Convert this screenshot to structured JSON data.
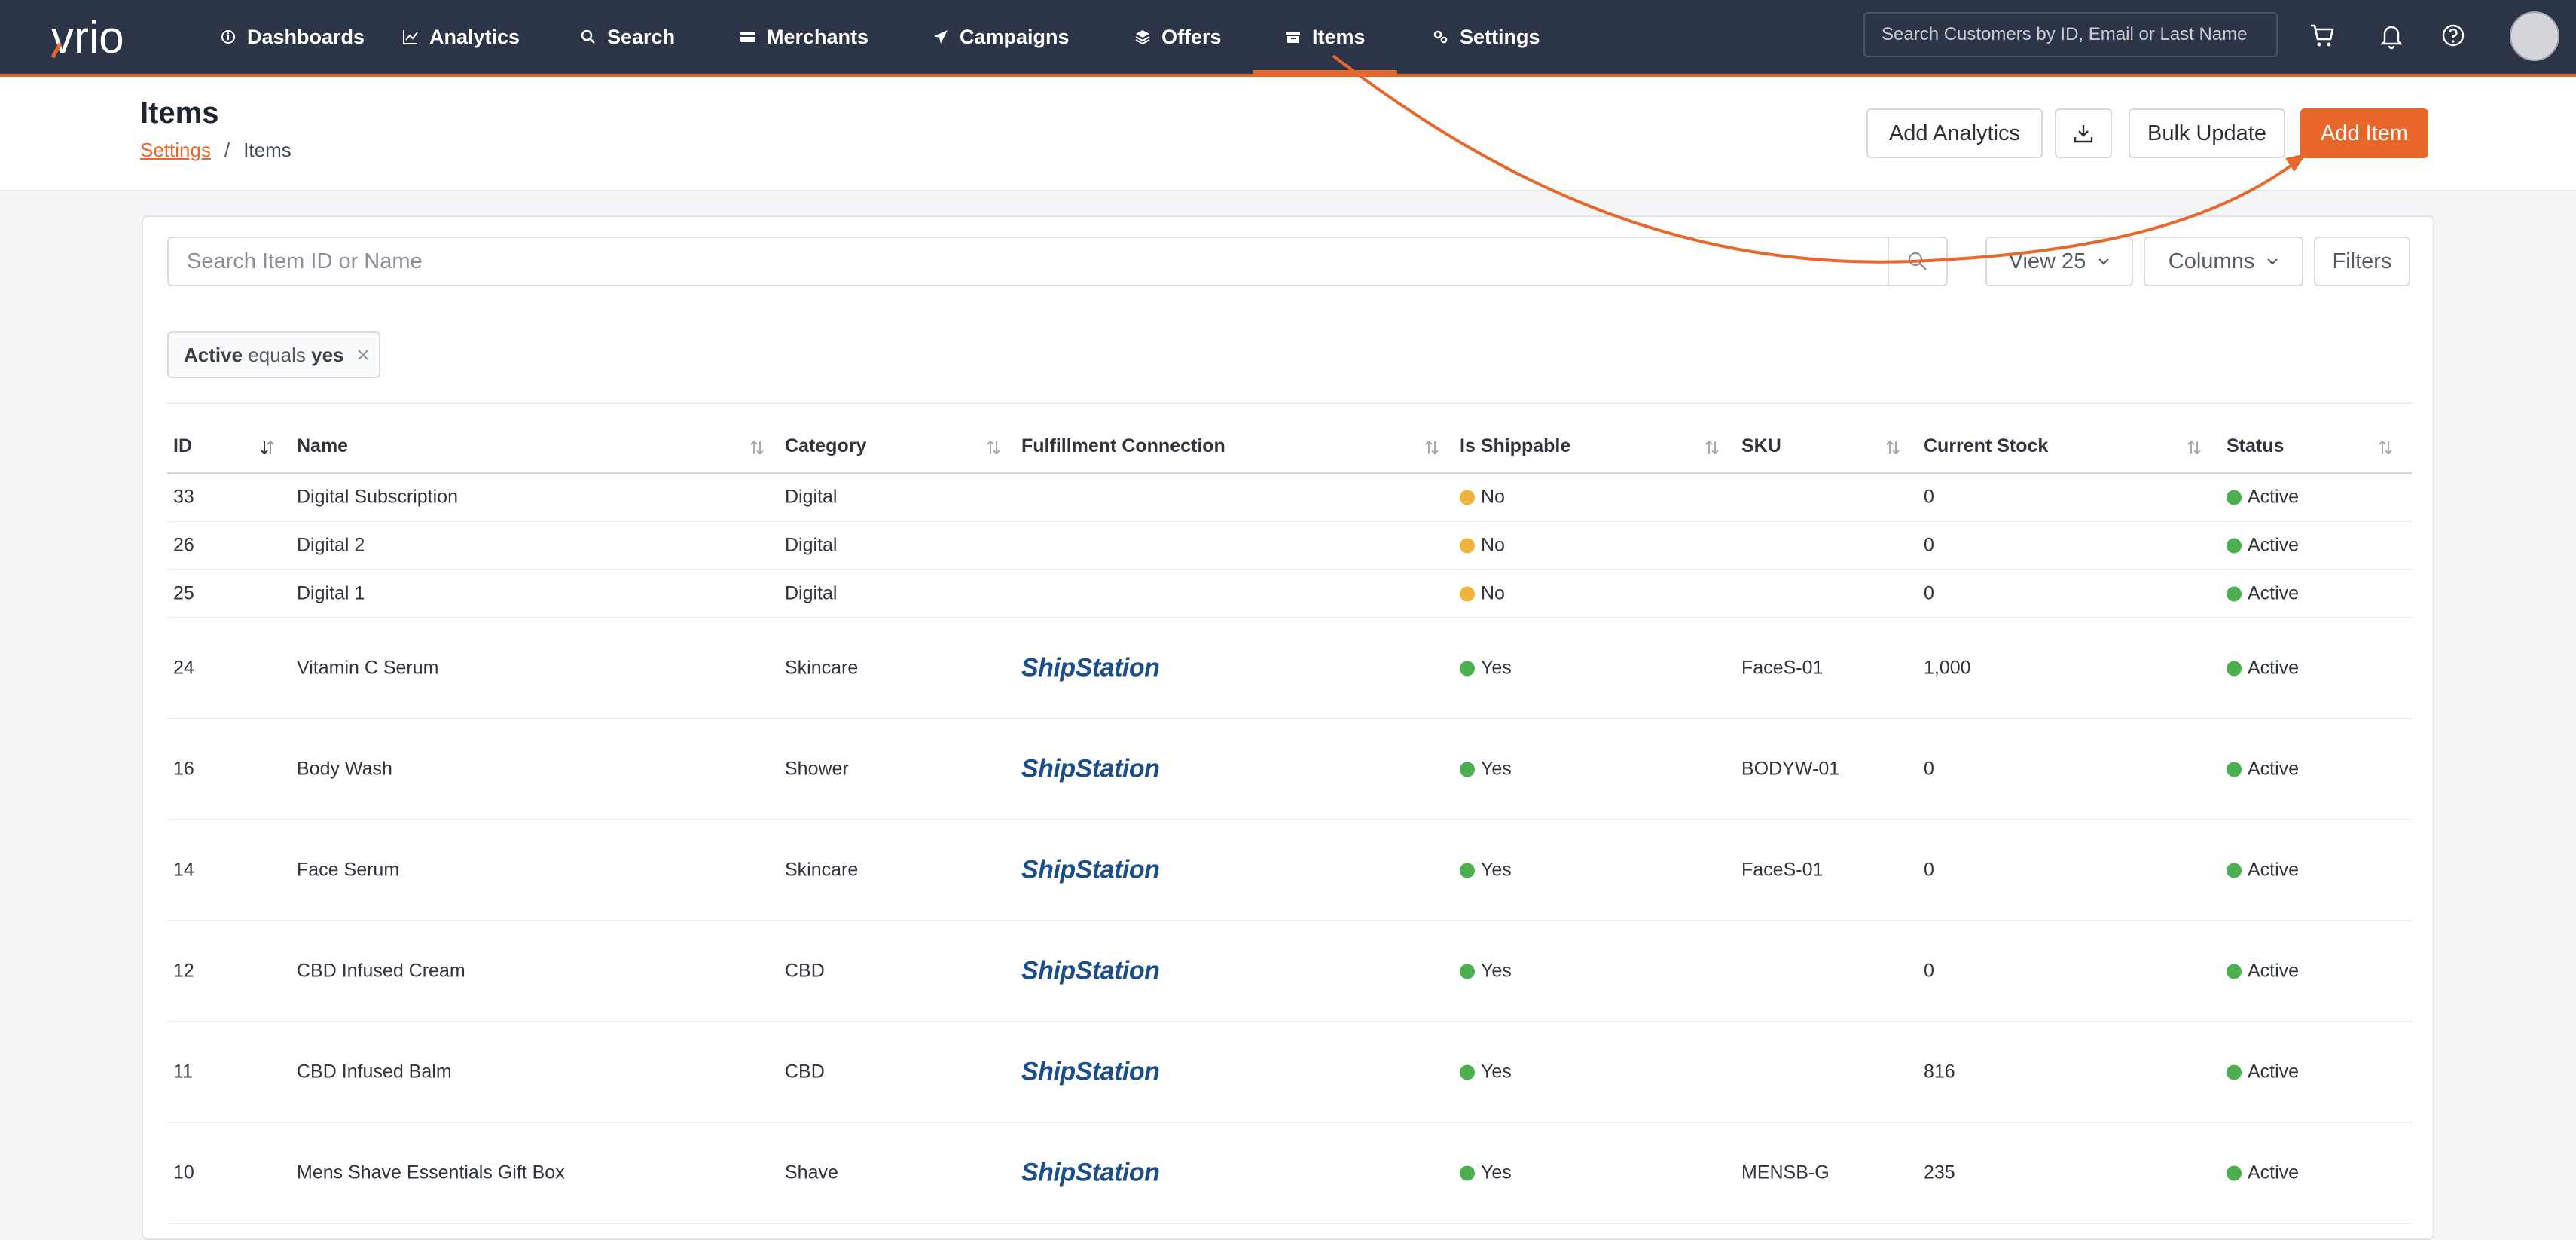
{
  "nav": {
    "logo_text": "vrio",
    "items": [
      {
        "label": "Dashboards",
        "icon": "info-circle-icon"
      },
      {
        "label": "Analytics",
        "icon": "line-chart-icon"
      },
      {
        "label": "Search",
        "icon": "search-icon"
      },
      {
        "label": "Merchants",
        "icon": "card-icon"
      },
      {
        "label": "Campaigns",
        "icon": "send-icon"
      },
      {
        "label": "Offers",
        "icon": "layers-icon"
      },
      {
        "label": "Items",
        "icon": "box-icon",
        "active": true
      },
      {
        "label": "Settings",
        "icon": "gears-icon"
      }
    ],
    "search_placeholder": "Search Customers by ID, Email or Last Name"
  },
  "page": {
    "title": "Items",
    "breadcrumb_link": "Settings",
    "breadcrumb_sep": "/",
    "breadcrumb_current": "Items",
    "buttons": {
      "add_analytics": "Add Analytics",
      "bulk_update": "Bulk Update",
      "add_item": "Add Item"
    }
  },
  "toolbar": {
    "search_placeholder": "Search Item ID or Name",
    "view": "View 25",
    "columns": "Columns",
    "filters": "Filters"
  },
  "filter_chip": {
    "field": "Active",
    "op": "equals",
    "value": "yes"
  },
  "table": {
    "headers": {
      "id": "ID",
      "name": "Name",
      "category": "Category",
      "fulfillment": "Fulfillment Connection",
      "shippable": "Is Shippable",
      "sku": "SKU",
      "stock": "Current Stock",
      "status": "Status"
    },
    "rows": [
      {
        "id": "33",
        "name": "Digital Subscription",
        "category": "Digital",
        "fulfillment": "",
        "shippable": "No",
        "sku": "",
        "stock": "0",
        "status": "Active"
      },
      {
        "id": "26",
        "name": "Digital 2",
        "category": "Digital",
        "fulfillment": "",
        "shippable": "No",
        "sku": "",
        "stock": "0",
        "status": "Active"
      },
      {
        "id": "25",
        "name": "Digital 1",
        "category": "Digital",
        "fulfillment": "",
        "shippable": "No",
        "sku": "",
        "stock": "0",
        "status": "Active"
      },
      {
        "id": "24",
        "name": "Vitamin C Serum",
        "category": "Skincare",
        "fulfillment": "ShipStation",
        "shippable": "Yes",
        "sku": "FaceS-01",
        "stock": "1,000",
        "status": "Active"
      },
      {
        "id": "16",
        "name": "Body Wash",
        "category": "Shower",
        "fulfillment": "ShipStation",
        "shippable": "Yes",
        "sku": "BODYW-01",
        "stock": "0",
        "status": "Active"
      },
      {
        "id": "14",
        "name": "Face Serum",
        "category": "Skincare",
        "fulfillment": "ShipStation",
        "shippable": "Yes",
        "sku": "FaceS-01",
        "stock": "0",
        "status": "Active"
      },
      {
        "id": "12",
        "name": "CBD Infused Cream",
        "category": "CBD",
        "fulfillment": "ShipStation",
        "shippable": "Yes",
        "sku": "",
        "stock": "0",
        "status": "Active"
      },
      {
        "id": "11",
        "name": "CBD Infused Balm",
        "category": "CBD",
        "fulfillment": "ShipStation",
        "shippable": "Yes",
        "sku": "",
        "stock": "816",
        "status": "Active"
      },
      {
        "id": "10",
        "name": "Mens Shave Essentials Gift Box",
        "category": "Shave",
        "fulfillment": "ShipStation",
        "shippable": "Yes",
        "sku": "MENSB-G",
        "stock": "235",
        "status": "Active"
      }
    ]
  },
  "colors": {
    "nav_bg": "#2c3547",
    "accent": "#e8672a",
    "status_yes": "#4caf50",
    "status_no": "#f0b43c"
  }
}
